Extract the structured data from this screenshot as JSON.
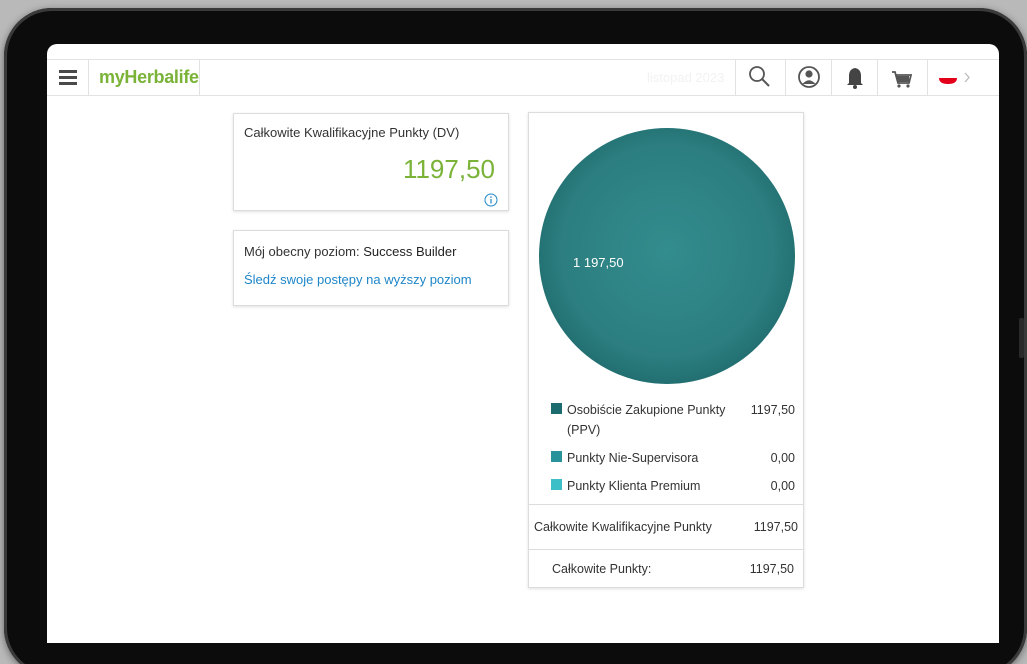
{
  "header": {
    "logo": "myHerbalife",
    "date": "listopad 2023",
    "icons": [
      "menu-icon",
      "search-icon",
      "user-icon",
      "bell-icon",
      "cart-icon",
      "flag-icon"
    ]
  },
  "dv_card": {
    "title": "Całkowite Kwalifikacyjne Punkty (DV)",
    "value": "1197,50"
  },
  "level_card": {
    "prefix": "Mój obecny poziom:",
    "level": "Success Builder",
    "link": "Śledź swoje postępy na wyższy poziom"
  },
  "chart_data": {
    "type": "pie",
    "slices": [
      {
        "label": "Osobiście Zakupione Punkty (PPV)",
        "value": 1197.5,
        "display": "1197,50",
        "color": "#1c6b6e"
      },
      {
        "label": "Punkty Nie-Supervisora",
        "value": 0.0,
        "display": "0,00",
        "color": "#28939a"
      },
      {
        "label": "Punkty Klienta Premium",
        "value": 0.0,
        "display": "0,00",
        "color": "#3cbfc7"
      }
    ],
    "data_label": "1 197,50",
    "legend_position": "bottom"
  },
  "summary": {
    "total_qualifying_label": "Całkowite Kwalifikacyjne Punkty",
    "total_qualifying_value": "1197,50",
    "total_points_label": "Całkowite Punkty:",
    "total_points_value": "1197,50"
  },
  "colors": {
    "brand_green": "#7ab338",
    "link_blue": "#1e86c8",
    "pie_teal": "#2c7e80"
  }
}
